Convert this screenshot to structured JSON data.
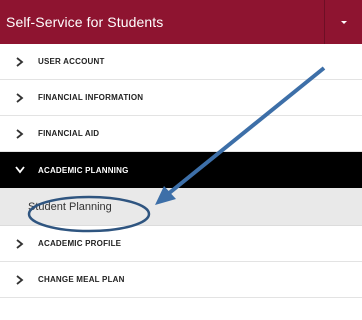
{
  "header": {
    "title": "Self-Service for Students"
  },
  "menu": {
    "items": [
      {
        "label": "USER ACCOUNT",
        "state": "collapsed"
      },
      {
        "label": "FINANCIAL INFORMATION",
        "state": "collapsed"
      },
      {
        "label": "FINANCIAL AID",
        "state": "collapsed"
      },
      {
        "label": "ACADEMIC PLANNING",
        "state": "expanded",
        "children": [
          {
            "label": "Student Planning"
          }
        ]
      },
      {
        "label": "ACADEMIC PROFILE",
        "state": "collapsed"
      },
      {
        "label": "CHANGE MEAL PLAN",
        "state": "collapsed"
      }
    ]
  },
  "annotation": {
    "arrow_color": "#3d6fa8",
    "ellipse_color": "#2f5580"
  },
  "colors": {
    "header_bg": "#8e1430",
    "expanded_bg": "#000000",
    "subitem_bg": "#e9e9e9"
  }
}
